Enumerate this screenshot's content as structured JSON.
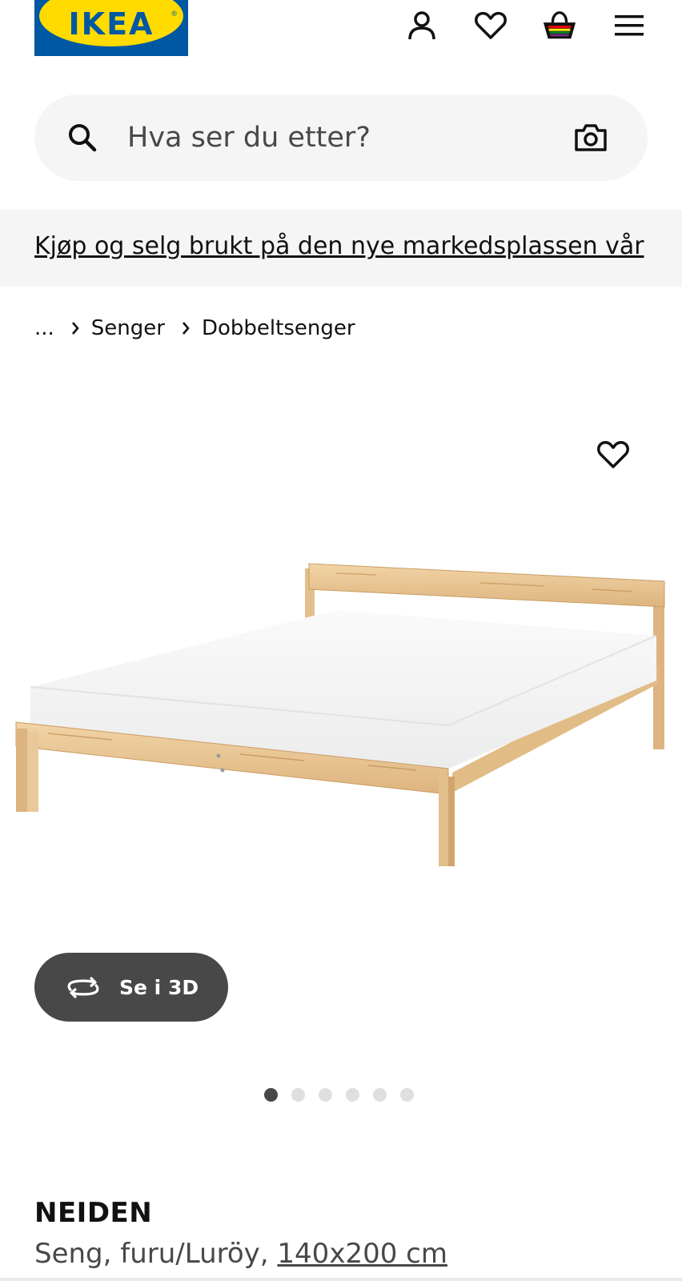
{
  "header": {
    "logo_text": "IKEA",
    "icons": [
      "account-icon",
      "heart-icon",
      "basket-icon",
      "menu-icon"
    ]
  },
  "search": {
    "placeholder": "Hva ser du etter?"
  },
  "banner": {
    "text": "Kjøp og selg brukt på den nye markedsplassen vår"
  },
  "breadcrumb": {
    "ellipsis": "...",
    "items": [
      "Senger",
      "Dobbeltsenger"
    ]
  },
  "gallery": {
    "button_3d": "Se i 3D",
    "dots_count": 6,
    "active_dot": 0
  },
  "product": {
    "name": "NEIDEN",
    "description": "Seng, furu/Luröy, ",
    "size": "140x200 cm"
  },
  "colors": {
    "ikea_blue": "#0058A3",
    "ikea_yellow": "#FFDB00",
    "dark_grey": "#484848",
    "light_grey": "#F5F5F5"
  }
}
